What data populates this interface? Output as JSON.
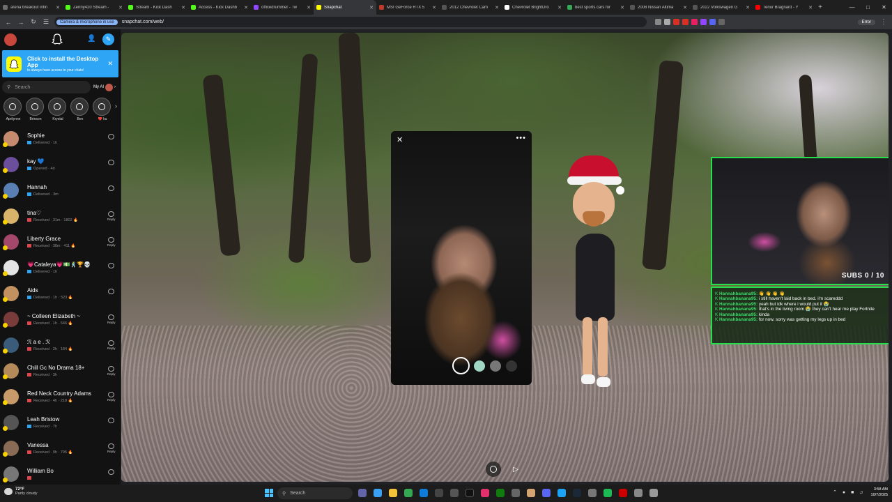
{
  "browser": {
    "tabs": [
      {
        "label": "arena breakout infin",
        "color": "#6e6e6e"
      },
      {
        "label": "Zenny420 Stream -",
        "color": "#53fc18"
      },
      {
        "label": "Stream - Kick Dash",
        "color": "#53fc18"
      },
      {
        "label": "Access - Kick Dashb",
        "color": "#53fc18"
      },
      {
        "label": "officedrummer - Tw",
        "color": "#9146ff"
      },
      {
        "label": "Snapchat",
        "color": "#fffc00",
        "active": true
      },
      {
        "label": "MSI GeForce RTX 5",
        "color": "#c0392b"
      },
      {
        "label": "2012 Chevrolet Cam",
        "color": "#555555"
      },
      {
        "label": "Chevrolet BrightDro",
        "color": "#ffffff"
      },
      {
        "label": "best sports cars for",
        "color": "#34a853"
      },
      {
        "label": "2008 Nissan Altima",
        "color": "#555555"
      },
      {
        "label": "2022 Volkswagen G",
        "color": "#555555"
      },
      {
        "label": "Tenur Bragnard - Y",
        "color": "#ff0000"
      }
    ],
    "camera_chip": "Camera & microphone in use",
    "url": "snapchat.com/web/",
    "profile_label": "Error"
  },
  "sidebar": {
    "install": {
      "title": "Click to install the Desktop App",
      "subtitle": "to always have access to your chats!"
    },
    "search_placeholder": "Search",
    "my_ai_label": "My AI",
    "stories": [
      "Aprilynnn",
      "Brinson",
      "Krystal",
      "Ben",
      "❤️ ku"
    ],
    "chats": [
      {
        "name": "Sophie",
        "status": "Delivered · 1h",
        "kind": "delivered",
        "reply": false,
        "avatar": "#c68b6e"
      },
      {
        "name": "kay 💙",
        "status": "Opened · 4d",
        "kind": "opened",
        "reply": false,
        "avatar": "#6b4f9c"
      },
      {
        "name": "Hannah",
        "status": "Delivered · 3m",
        "kind": "delivered",
        "reply": false,
        "avatar": "#5a7fb5"
      },
      {
        "name": "tina♡",
        "status": "Received · 31m · 1802 🔥",
        "kind": "received",
        "reply": true,
        "avatar": "#d9b36a"
      },
      {
        "name": "Liberty Grace",
        "status": "Received · 38m · 411 🔥",
        "kind": "received",
        "reply": true,
        "avatar": "#a3476b"
      },
      {
        "name": "💗Cataleya💗💵🕺🏆💀",
        "status": "Delivered · 1h",
        "kind": "delivered",
        "reply": false,
        "avatar": "#e4e4e4"
      },
      {
        "name": "Aids",
        "status": "Delivered · 1h · 523 🔥",
        "kind": "delivered",
        "reply": false,
        "avatar": "#c2915f"
      },
      {
        "name": "~ Colleen Elizabeth ~",
        "status": "Received · 1h · 646 🔥",
        "kind": "received",
        "reply": true,
        "avatar": "#7a3b3b"
      },
      {
        "name": "ℛ a e . ℛ",
        "status": "Received · 2h · 184 🔥",
        "kind": "received",
        "reply": true,
        "avatar": "#3b5b7a"
      },
      {
        "name": "Chill Gc No Drama 18+",
        "status": "Received · 3h",
        "kind": "received",
        "reply": true,
        "avatar": "#b58a5a"
      },
      {
        "name": "Red Neck Country Adams",
        "status": "Received · 4h · 218 🔥",
        "kind": "received",
        "reply": true,
        "avatar": "#c89a6a"
      },
      {
        "name": "Leah Bristow",
        "status": "Received · 7h",
        "kind": "received-chat",
        "reply": false,
        "avatar": "#555555"
      },
      {
        "name": "Vanessa",
        "status": "Received · 9h · 795 🔥",
        "kind": "received",
        "reply": true,
        "avatar": "#8a6b55"
      },
      {
        "name": "William Bo",
        "status": "",
        "kind": "received",
        "reply": false,
        "avatar": "#777777"
      }
    ],
    "reply_label": "Reply"
  },
  "stream": {
    "subs_text": "SUBS 0 / 10",
    "chat": [
      {
        "user": "Hannahbanana95:",
        "msg": "👋 👋 👋 👋"
      },
      {
        "user": "Hannahbanana95:",
        "msg": "i still haven't laid back in bed. i'm scareddd"
      },
      {
        "user": "Hannahbanana95:",
        "msg": "yeah but idk where i would put it 😭"
      },
      {
        "user": "Hannahbanana95:",
        "msg": "that's in the living room 😭 they can't hear me play Fortnite"
      },
      {
        "user": "Hannahbanana95:",
        "msg": "kinda"
      },
      {
        "user": "Hannahbanana95:",
        "msg": "for now. sorry was getting my legs up in bed"
      }
    ]
  },
  "taskbar": {
    "temperature": "72°F",
    "weather": "Partly cloudy",
    "search_placeholder": "Search",
    "time": "3:58 AM",
    "date": "10/7/2025"
  }
}
